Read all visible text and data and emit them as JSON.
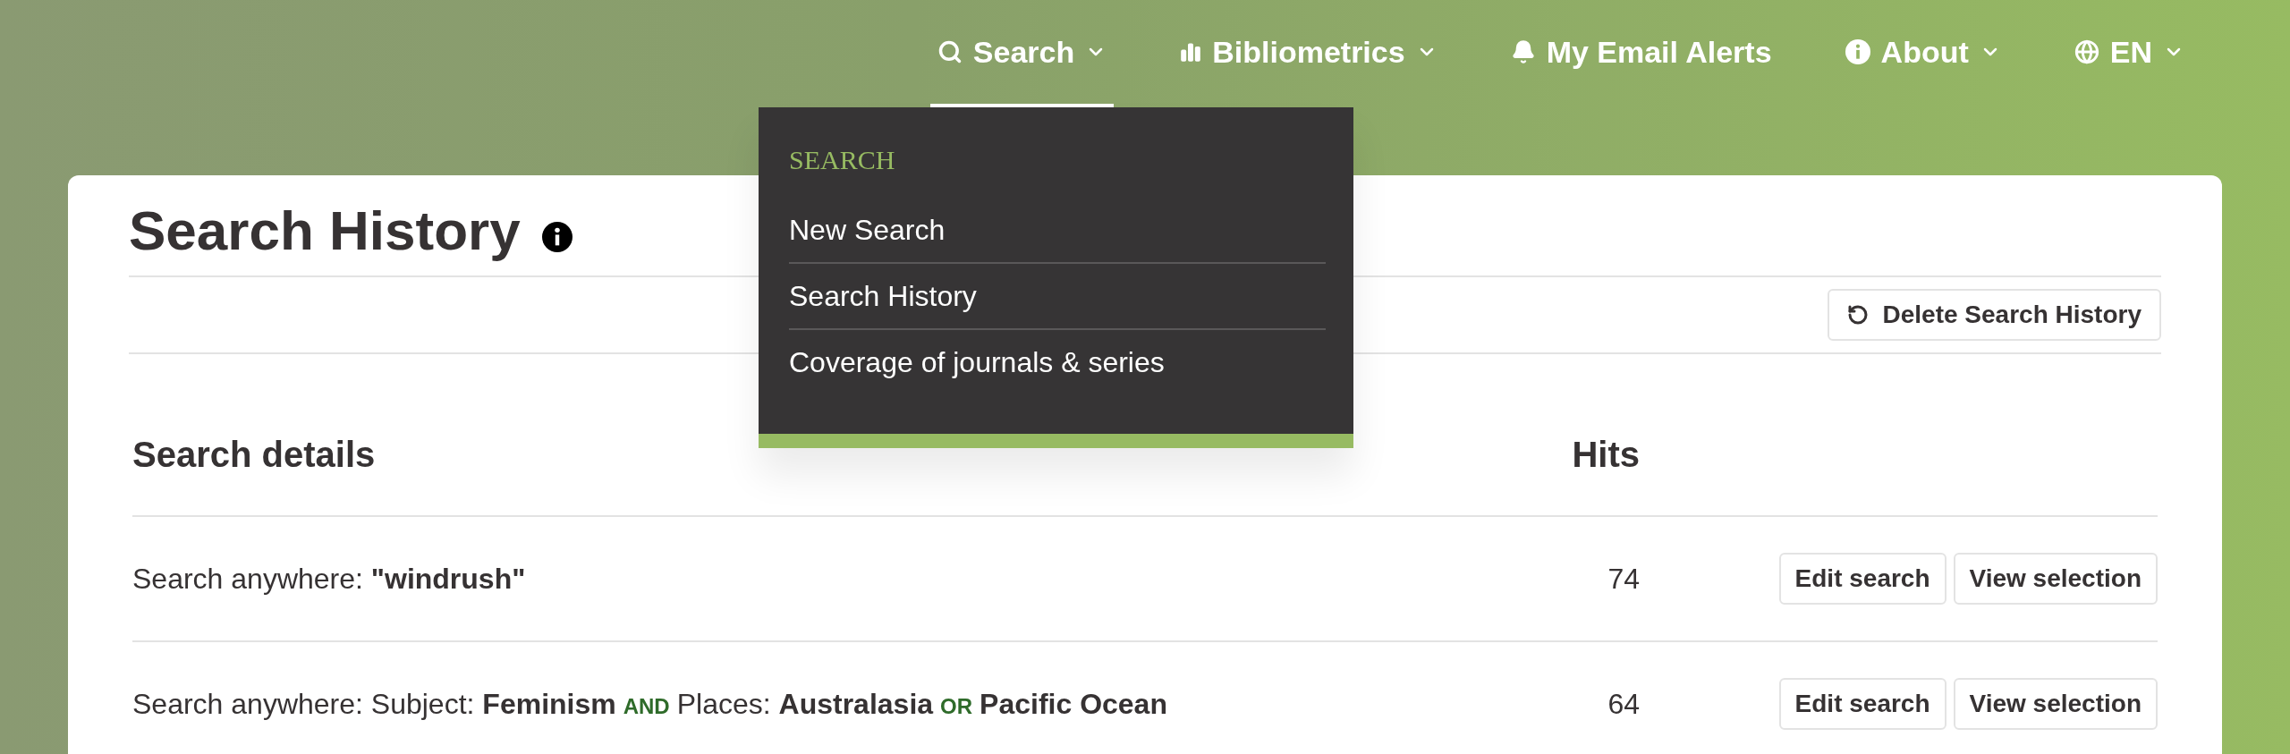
{
  "nav": [
    {
      "label": "Search",
      "kind": "search",
      "dropdown": true,
      "selected": true
    },
    {
      "label": "Bibliometrics",
      "kind": "chart",
      "dropdown": true,
      "selected": false
    },
    {
      "label": "My Email Alerts",
      "kind": "bell",
      "dropdown": false,
      "selected": false
    },
    {
      "label": "About",
      "kind": "info",
      "dropdown": true,
      "selected": false
    },
    {
      "label": "EN",
      "kind": "globe",
      "dropdown": true,
      "selected": false
    }
  ],
  "menu": {
    "heading": "SEARCH",
    "items": [
      "New Search",
      "Search History",
      "Coverage of journals & series"
    ]
  },
  "page": {
    "title": "Search History",
    "delete_button": "Delete Search History"
  },
  "table": {
    "columns": [
      "Search details",
      "Hits"
    ],
    "rows": [
      {
        "query": [
          {
            "kind": "text",
            "text": "Search anywhere: "
          },
          {
            "kind": "term",
            "text": "\"windrush\""
          }
        ],
        "hits": "74",
        "actions": [
          "Edit search",
          "View selection"
        ]
      },
      {
        "query": [
          {
            "kind": "text",
            "text": "Search anywhere: Subject: "
          },
          {
            "kind": "term",
            "text": "Feminism"
          },
          {
            "kind": "operator",
            "text": "AND"
          },
          {
            "kind": "text",
            "text": "Places: "
          },
          {
            "kind": "term",
            "text": "Australasia"
          },
          {
            "kind": "operator",
            "text": "OR"
          },
          {
            "kind": "term",
            "text": "Pacific Ocean"
          }
        ],
        "hits": "64",
        "actions": [
          "Edit search",
          "View selection"
        ]
      }
    ]
  }
}
